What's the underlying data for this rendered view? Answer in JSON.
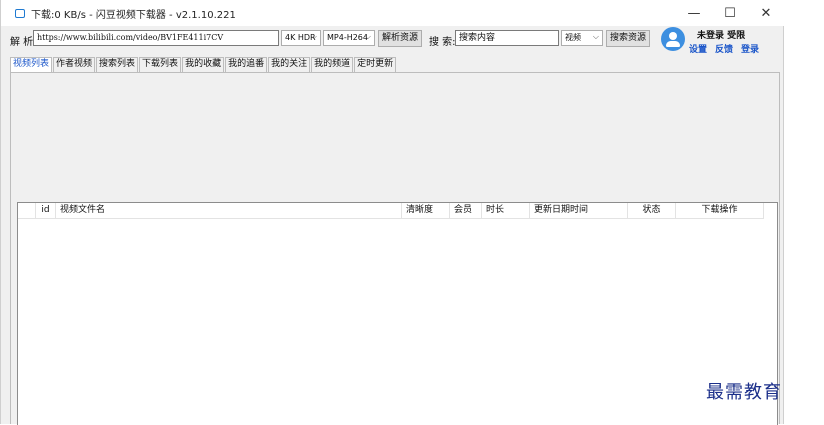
{
  "window": {
    "title": "下载:0 KB/s - 闪豆视频下载器 - v2.1.10.221",
    "controls": {
      "minimize": "—",
      "maximize": "☐",
      "close": "✕"
    }
  },
  "toolbar": {
    "parse_label": "解 析:",
    "url_value": "https://www.bilibili.com/video/BV1FE411i7CV",
    "quality_selected": "4K HDR",
    "format_selected": "MP4-H264",
    "parse_button": "解析资源",
    "search_label": "搜 索:",
    "search_placeholder": "搜索内容",
    "search_type_selected": "视频",
    "search_button": "搜索资源"
  },
  "user": {
    "status": "未登录 受限",
    "links": [
      "设置",
      "反馈",
      "登录"
    ],
    "accent": "#1a55c9"
  },
  "tabs": [
    "视频列表",
    "作者视频",
    "搜索列表",
    "下载列表",
    "我的收藏",
    "我的追番",
    "我的关注",
    "我的频道",
    "定时更新"
  ],
  "list": {
    "columns": [
      "id",
      "视频文件名",
      "清晰度",
      "会员",
      "时长",
      "更新日期时间",
      "状态",
      "下载操作"
    ],
    "rows": []
  },
  "watermark": "最需教育"
}
